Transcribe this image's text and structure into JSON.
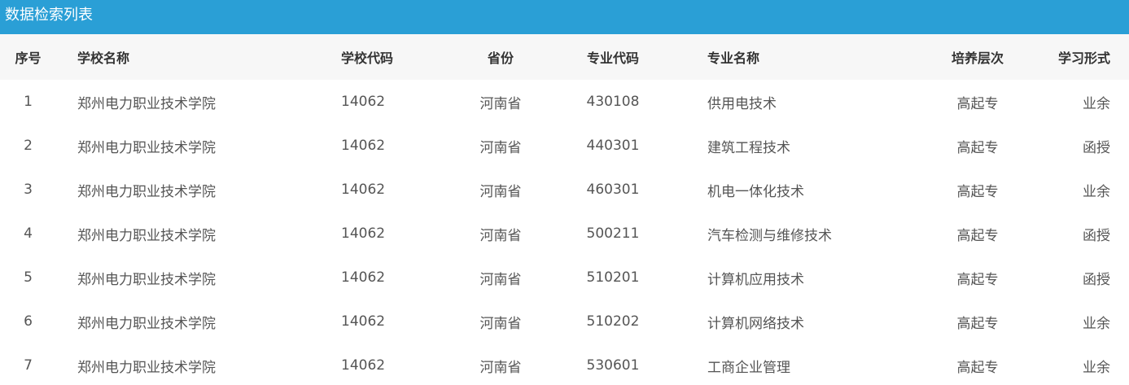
{
  "panel": {
    "title": "数据检索列表"
  },
  "table": {
    "headers": [
      "序号",
      "学校名称",
      "学校代码",
      "省份",
      "专业代码",
      "专业名称",
      "培养层次",
      "学习形式"
    ],
    "rows": [
      [
        "1",
        "郑州电力职业技术学院",
        "14062",
        "河南省",
        "430108",
        "供用电技术",
        "高起专",
        "业余"
      ],
      [
        "2",
        "郑州电力职业技术学院",
        "14062",
        "河南省",
        "440301",
        "建筑工程技术",
        "高起专",
        "函授"
      ],
      [
        "3",
        "郑州电力职业技术学院",
        "14062",
        "河南省",
        "460301",
        "机电一体化技术",
        "高起专",
        "业余"
      ],
      [
        "4",
        "郑州电力职业技术学院",
        "14062",
        "河南省",
        "500211",
        "汽车检测与维修技术",
        "高起专",
        "函授"
      ],
      [
        "5",
        "郑州电力职业技术学院",
        "14062",
        "河南省",
        "510201",
        "计算机应用技术",
        "高起专",
        "函授"
      ],
      [
        "6",
        "郑州电力职业技术学院",
        "14062",
        "河南省",
        "510202",
        "计算机网络技术",
        "高起专",
        "业余"
      ],
      [
        "7",
        "郑州电力职业技术学院",
        "14062",
        "河南省",
        "530601",
        "工商企业管理",
        "高起专",
        "业余"
      ]
    ]
  },
  "colors": {
    "title_bar": "#2a9fd6",
    "header_bg": "#f7f7f7"
  }
}
